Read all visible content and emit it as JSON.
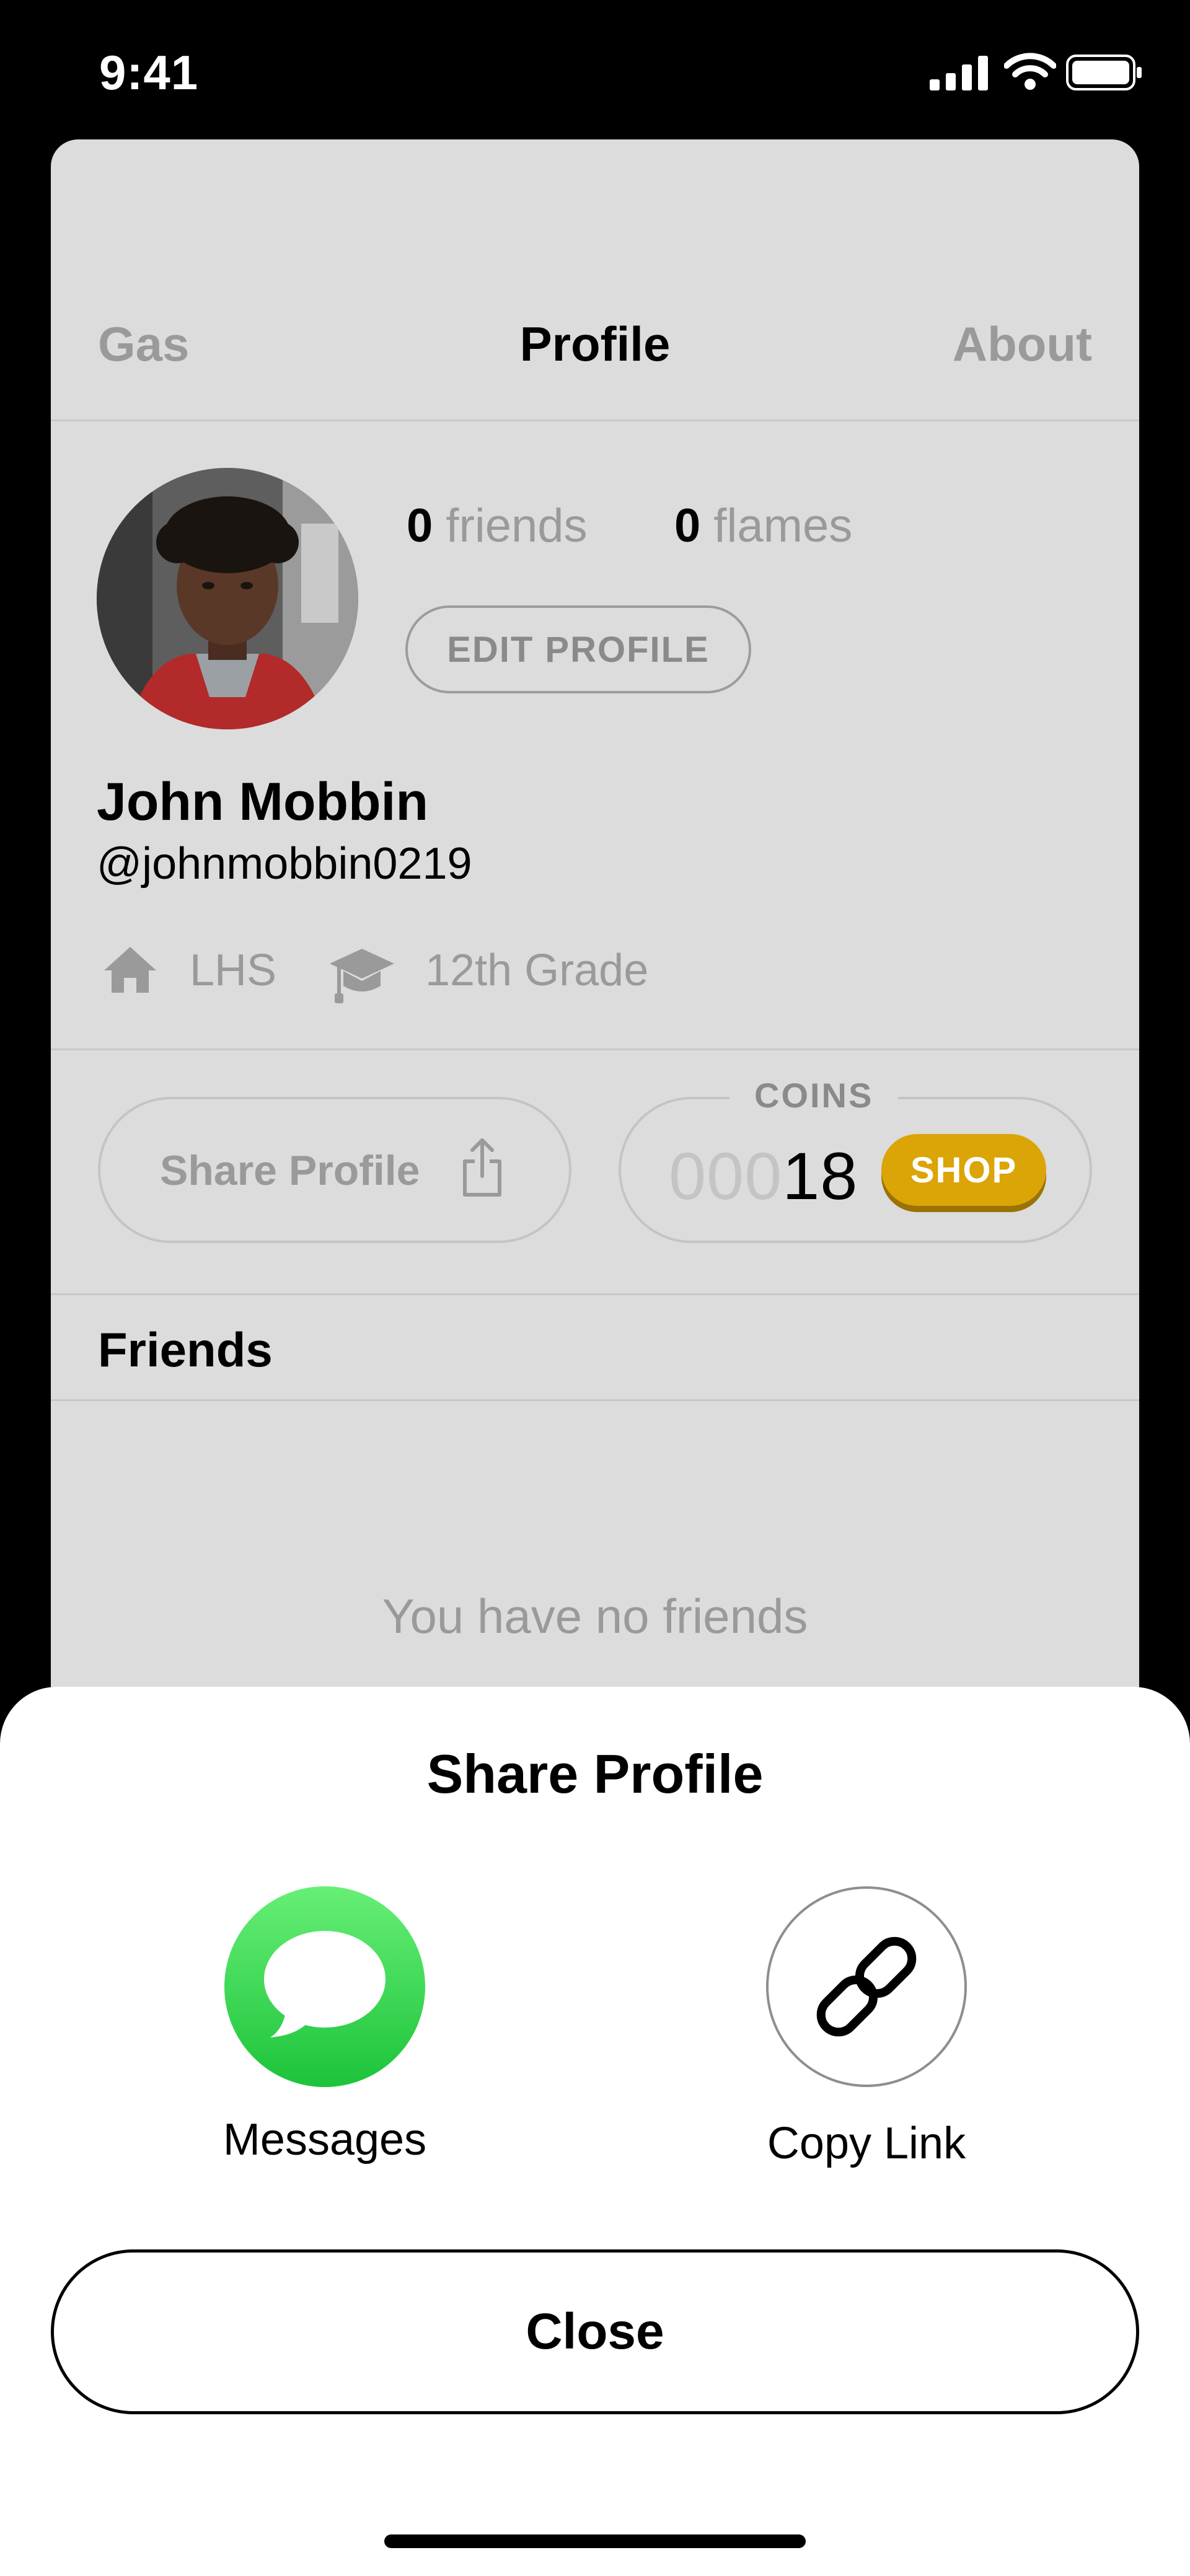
{
  "status_bar": {
    "time": "9:41"
  },
  "tabs": [
    {
      "label": "Gas"
    },
    {
      "label": "Profile"
    },
    {
      "label": "About"
    }
  ],
  "profile": {
    "friends_count": "0",
    "friends_label": "friends",
    "flames_count": "0",
    "flames_label": "flames",
    "edit_label": "EDIT PROFILE",
    "name": "John Mobbin",
    "handle": "@johnmobbin0219",
    "school": "LHS",
    "grade": "12th Grade"
  },
  "actions": {
    "share_label": "Share Profile",
    "coins_label": "COINS",
    "coins_leading": "000",
    "coins_value": "18",
    "shop_label": "SHOP"
  },
  "friends": {
    "title": "Friends",
    "empty_text": "You have no friends"
  },
  "sheet": {
    "title": "Share Profile",
    "options": [
      {
        "label": "Messages",
        "icon": "messages-icon"
      },
      {
        "label": "Copy Link",
        "icon": "link-icon"
      }
    ],
    "close_label": "Close"
  },
  "colors": {
    "card_bg": "#dcdcdc",
    "shop_yellow": "#dba407",
    "messages_green": "#34c759"
  }
}
